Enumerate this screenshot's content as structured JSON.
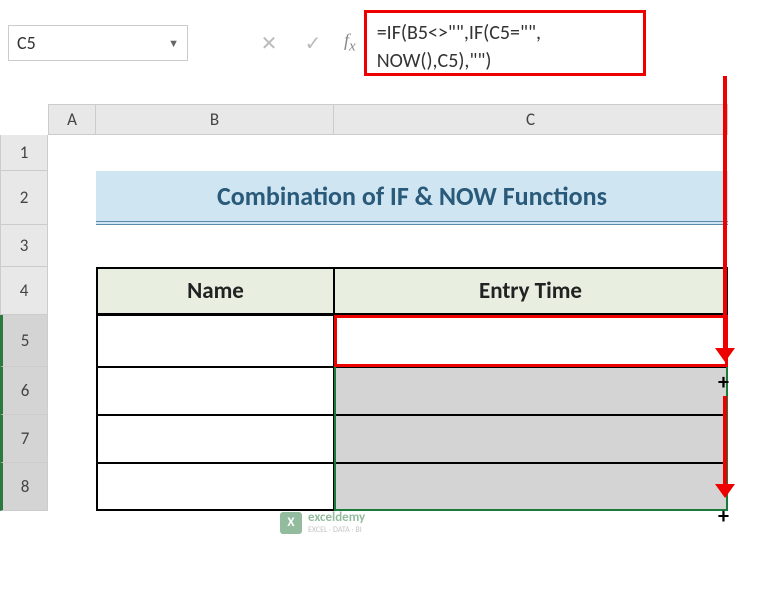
{
  "name_box": {
    "value": "C5"
  },
  "formula_bar": {
    "value": "=IF(B5<>\"\",IF(C5=\"\", NOW(),C5),\"\")"
  },
  "columns": {
    "a": "A",
    "b": "B",
    "c": "C"
  },
  "rows": {
    "r1": "1",
    "r2": "2",
    "r3": "3",
    "r4": "4",
    "r5": "5",
    "r6": "6",
    "r7": "7",
    "r8": "8"
  },
  "title": "Combination of IF & NOW Functions",
  "headers": {
    "name": "Name",
    "entry_time": "Entry Time"
  },
  "watermark": {
    "brand": "exceldemy",
    "tagline": "EXCEL · DATA · BI",
    "icon": "X"
  },
  "chart_data": {
    "type": "table",
    "title": "Combination of IF & NOW Functions",
    "columns": [
      "Name",
      "Entry Time"
    ],
    "rows": [
      {
        "Name": "",
        "Entry Time": ""
      },
      {
        "Name": "",
        "Entry Time": ""
      },
      {
        "Name": "",
        "Entry Time": ""
      },
      {
        "Name": "",
        "Entry Time": ""
      }
    ],
    "active_cell": "C5",
    "formula": "=IF(B5<>\"\",IF(C5=\"\",NOW(),C5),\"\")"
  }
}
